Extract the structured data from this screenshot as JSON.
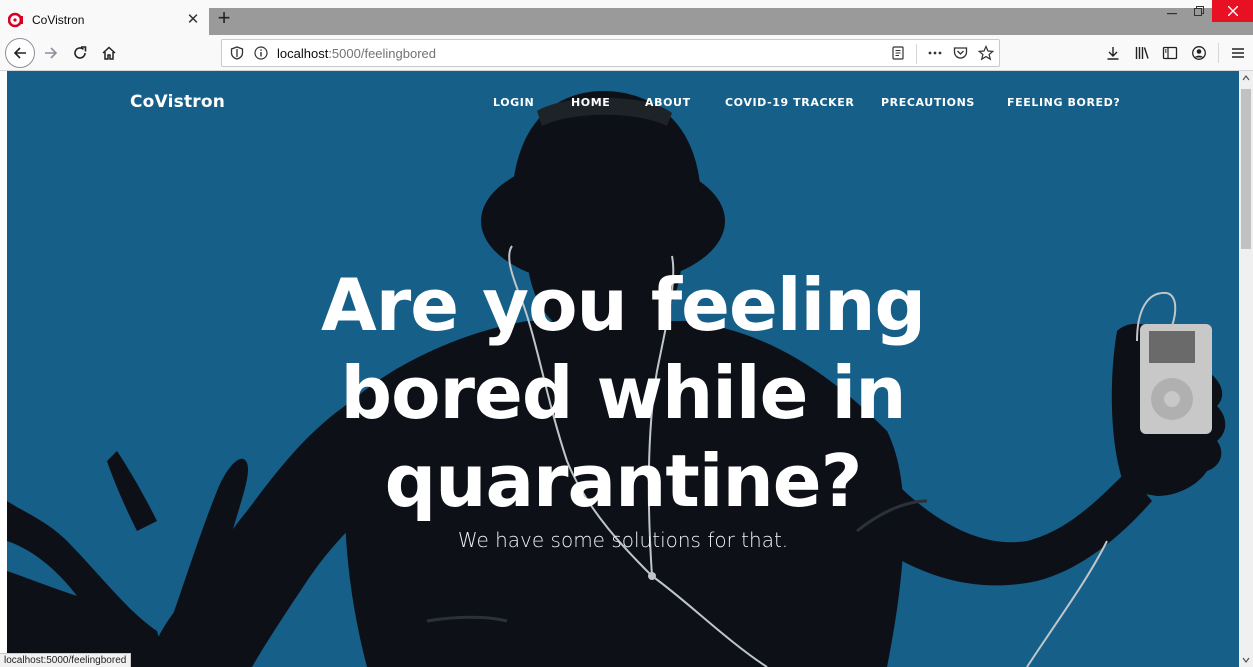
{
  "browser": {
    "tab_title": "CoVistron",
    "url_host": "localhost",
    "url_path": ":5000/feelingbored",
    "status_url": "localhost:5000/feelingbored"
  },
  "site": {
    "brand": "CoVistron",
    "nav": [
      {
        "label": "LOGIN"
      },
      {
        "label": "HOME"
      },
      {
        "label": "ABOUT"
      },
      {
        "label": "COVID-19 TRACKER"
      },
      {
        "label": "PRECAUTIONS"
      },
      {
        "label": "FEELING BORED?"
      }
    ]
  },
  "hero": {
    "title_lines": [
      "Are you feeling",
      "bored while in",
      "quarantine?"
    ],
    "subtitle": "We have some solutions for that."
  },
  "colors": {
    "page_bg": "#155f88",
    "silhouette": "#0d1117",
    "close_button": "#e81123"
  }
}
